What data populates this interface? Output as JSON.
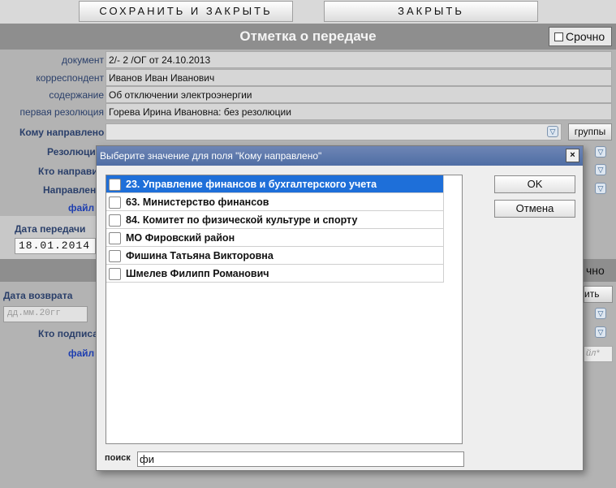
{
  "toolbar": {
    "save_close": "СОХРАНИТЬ И ЗАКРЫТЬ",
    "close": "ЗАКРЫТЬ"
  },
  "header": {
    "title": "Отметка о передаче",
    "urgent": "Срочно"
  },
  "form": {
    "rows": [
      {
        "label": "документ",
        "value": "2/- 2 /ОГ от 24.10.2013"
      },
      {
        "label": "корреспондент",
        "value": "Иванов Иван Иванович"
      },
      {
        "label": "содержание",
        "value": "Об отключении электроэнергии"
      },
      {
        "label": "первая резолюция",
        "value": "Горева Ирина Ивановна: без резолюции"
      }
    ],
    "kom_label": "Кому направлено",
    "groups_button": "группы",
    "rezol_label": "Резолюци",
    "kto_label": "Кто направи",
    "napr_label": "Направлен",
    "file_label": "файл",
    "date_label": "Дата передачи",
    "date_value": "18.01.2014",
    "return_label": "Дата возврата",
    "return_placeholder": "дд.мм.20гг",
    "signer_label": "Кто подписа",
    "file2_label": "файл",
    "urgent_partial": "чно",
    "add_partial": "ить",
    "file_partial": "йл*"
  },
  "modal": {
    "title": "Выберите значение для поля \"Кому направлено\"",
    "close": "×",
    "items": [
      {
        "label": "23. Управление финансов и бухгалтерского учета",
        "selected": true
      },
      {
        "label": "63. Министерство финансов",
        "selected": false
      },
      {
        "label": "84. Комитет по физической культуре и спорту",
        "selected": false
      },
      {
        "label": "МО Фировский район",
        "selected": false
      },
      {
        "label": "Фишина Татьяна Викторовна",
        "selected": false
      },
      {
        "label": "Шмелев Филипп Романович",
        "selected": false
      }
    ],
    "ok": "OK",
    "cancel": "Отмена",
    "search_label": "поиск",
    "search_value": "фи"
  },
  "colors": {
    "accent": "#1e6fd9",
    "title_bar": "#5b78ad",
    "header": "#8e8e8e"
  }
}
